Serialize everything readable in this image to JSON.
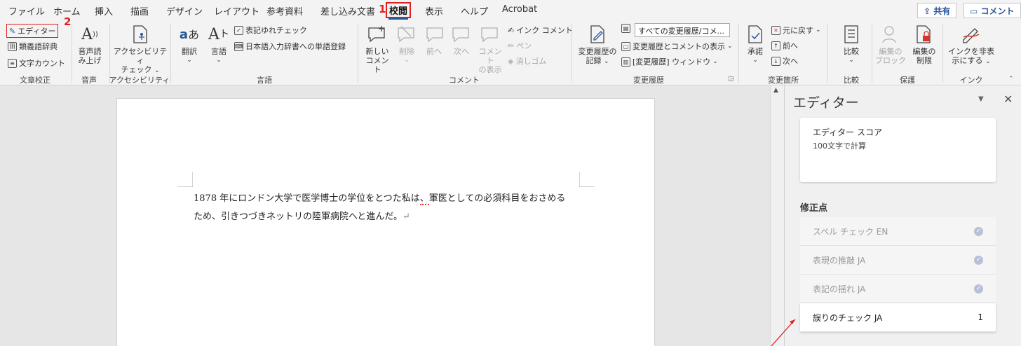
{
  "tabs": [
    "ファイル",
    "ホーム",
    "挿入",
    "描画",
    "デザイン",
    "レイアウト",
    "参考資料",
    "差し込み文書",
    "校閲",
    "表示",
    "ヘルプ",
    "Acrobat"
  ],
  "steps": {
    "one": "1",
    "two": "2"
  },
  "share": {
    "share_label": "共有",
    "comment_label": "コメント"
  },
  "ribbon": {
    "editor": "エディター",
    "thesaurus": "類義語辞典",
    "word_count": "文字カウント",
    "read_aloud": [
      "音声読",
      "み上げ"
    ],
    "accessibility": [
      "アクセシビリティ",
      "チェック"
    ],
    "translate": "翻訳",
    "language": "言語",
    "variant_check": "表記ゆれチェック",
    "ime_dict": "日本語入力辞書への単語登録",
    "new_comment": [
      "新しい",
      "コメント"
    ],
    "delete": "削除",
    "prev": "前へ",
    "next": "次へ",
    "show_comments": [
      "コメント",
      "の表示"
    ],
    "ink_comment": "インク コメント",
    "pen": "ペン",
    "eraser": "消しゴム",
    "track_changes": [
      "変更履歴の",
      "記録"
    ],
    "markup_combo": "すべての変更履歴/コメ...",
    "show_markup": "変更履歴とコメントの表示",
    "reviewing_pane": "[変更履歴] ウィンドウ",
    "accept": "承諾",
    "undo": "元に戻す",
    "prev2": "前へ",
    "next2": "次へ",
    "compare": "比較",
    "block": [
      "編集の",
      "ブロック"
    ],
    "restrict": [
      "編集の",
      "制限"
    ],
    "hide_ink": [
      "インクを非表",
      "示にする"
    ]
  },
  "groups": {
    "proofing": "文章校正",
    "speech": "音声",
    "accessibility": "アクセシビリティ",
    "language": "言語",
    "comments": "コメント",
    "tracking": "変更履歴",
    "changes": "変更箇所",
    "compare": "比較",
    "protect": "保護",
    "ink": "インク"
  },
  "document": {
    "line1_a": "1878 年にロンドン大学で医学博士の学位をとつた私は",
    "line1_b": "、",
    "line1_c": "軍医としての必須科目をおさめる",
    "line2": "ため、引きつづきネットリの陸軍病院へと進んだ。",
    "para_mark": "↵"
  },
  "pane": {
    "title": "エディター",
    "score_title": "エディター スコア",
    "score_sub": "100文字で計算",
    "section": "修正点",
    "items": [
      {
        "label": "スペル チェック  EN",
        "status": "done"
      },
      {
        "label": "表現の推敲  JA",
        "status": "done"
      },
      {
        "label": "表記の揺れ  JA",
        "status": "done"
      },
      {
        "label": "誤りのチェック  JA",
        "count": "1"
      }
    ]
  },
  "colors": {
    "accent": "#2b579a",
    "highlight": "#e02020"
  }
}
